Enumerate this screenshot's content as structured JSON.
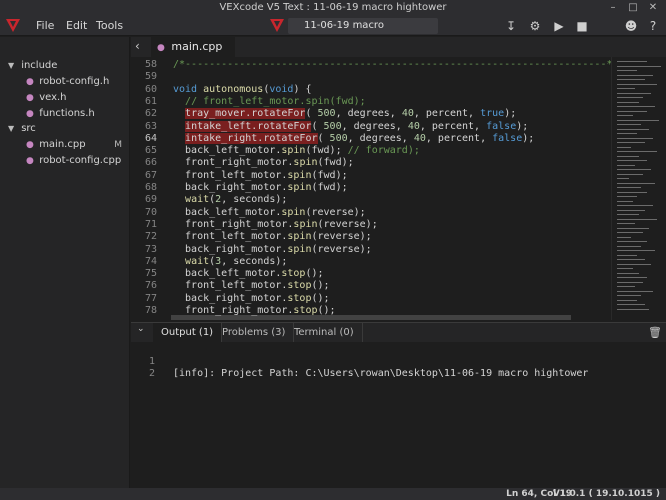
{
  "window": {
    "title": "VEXcode V5 Text : 11-06-19 macro hightower"
  },
  "menu": [
    "File",
    "Edit",
    "Tools"
  ],
  "project": {
    "name": "11-06-19 macro"
  },
  "colors": {
    "accent": "#c8262d",
    "highlight": "#7a1f1f",
    "keyword": "#569cd6",
    "function": "#dcdcaa",
    "comment": "#6a9955"
  },
  "sidebar": {
    "folders": [
      {
        "name": "include",
        "files": [
          "robot-config.h",
          "vex.h",
          "functions.h"
        ]
      },
      {
        "name": "src",
        "files": [
          "main.cpp",
          "robot-config.cpp"
        ]
      }
    ],
    "modified_badge": "M"
  },
  "editor": {
    "tab": "main.cpp",
    "lines": [
      {
        "n": "58",
        "t": "/*----------------------------------------------------------------------*/"
      },
      {
        "n": "59",
        "t": ""
      },
      {
        "n": "60",
        "t": "void autonomous(void) {"
      },
      {
        "n": "61",
        "t": "  // front_left_motor.spin(fwd);"
      },
      {
        "n": "62",
        "t": "  tray_mover.rotateFor( 500, degrees, 40, percent, true);"
      },
      {
        "n": "63",
        "t": "  intake_left.rotateFor( 500, degrees, 40, percent, false);"
      },
      {
        "n": "64",
        "t": "  intake_right.rotateFor( 500, degrees, 40, percent, false);"
      },
      {
        "n": "65",
        "t": "  back_left_motor.spin(fwd); // forward);"
      },
      {
        "n": "66",
        "t": "  front_right_motor.spin(fwd);"
      },
      {
        "n": "67",
        "t": "  front_left_motor.spin(fwd);"
      },
      {
        "n": "68",
        "t": "  back_right_motor.spin(fwd);"
      },
      {
        "n": "69",
        "t": "  wait(2, seconds);"
      },
      {
        "n": "70",
        "t": "  back_left_motor.spin(reverse);"
      },
      {
        "n": "71",
        "t": "  front_right_motor.spin(reverse);"
      },
      {
        "n": "72",
        "t": "  front_left_motor.spin(reverse);"
      },
      {
        "n": "73",
        "t": "  back_right_motor.spin(reverse);"
      },
      {
        "n": "74",
        "t": "  wait(3, seconds);"
      },
      {
        "n": "75",
        "t": "  back_left_motor.stop();"
      },
      {
        "n": "76",
        "t": "  front_left_motor.stop();"
      },
      {
        "n": "77",
        "t": "  back_right_motor.stop();"
      },
      {
        "n": "78",
        "t": "  front_right_motor.stop();"
      }
    ],
    "active_line": "64"
  },
  "panel": {
    "tabs": [
      "Output (1)",
      "Problems (3)",
      "Terminal (0)"
    ],
    "active_tab": "Output (1)",
    "lines": [
      {
        "n": "1",
        "t": "[info]: Project Path: C:\\Users\\rowan\\Desktop\\11-06-19 macro hightower"
      },
      {
        "n": "2",
        "t": ""
      }
    ]
  },
  "status": {
    "position": "Ln 64, Col 19",
    "version": "V1.0.1 ( 19.10.1015 )"
  },
  "icons": {
    "titlebar": [
      "minimize-icon",
      "maximize-icon",
      "close-icon"
    ],
    "toolbar": [
      "download-icon",
      "gears-icon",
      "play-icon",
      "stop-icon",
      "user-icon",
      "help-icon"
    ]
  }
}
